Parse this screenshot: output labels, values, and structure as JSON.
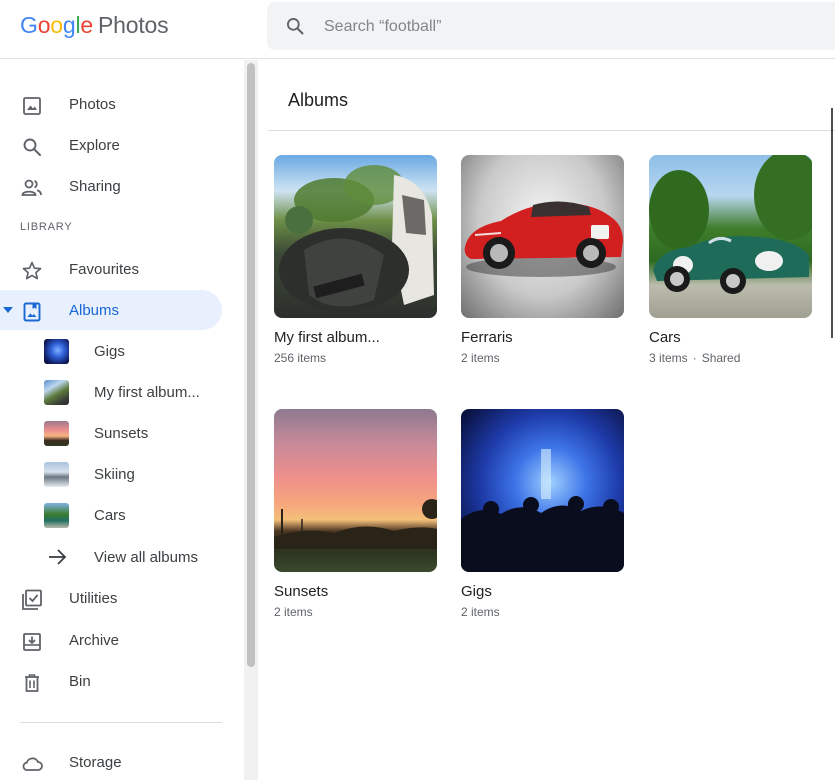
{
  "app": {
    "logo_letters": [
      "G",
      "o",
      "o",
      "g",
      "l",
      "e"
    ],
    "product_name": "Photos"
  },
  "search": {
    "placeholder": "Search “football”",
    "icon": "search-icon"
  },
  "sidebar": {
    "nav": [
      {
        "label": "Photos",
        "icon": "photo-icon"
      },
      {
        "label": "Explore",
        "icon": "search-icon"
      },
      {
        "label": "Sharing",
        "icon": "people-icon"
      }
    ],
    "library_label": "LIBRARY",
    "library": [
      {
        "label": "Favourites",
        "icon": "star-icon"
      },
      {
        "label": "Albums",
        "icon": "album-icon",
        "active": true
      }
    ],
    "albums": [
      {
        "label": "Gigs"
      },
      {
        "label": "My first album..."
      },
      {
        "label": "Sunsets"
      },
      {
        "label": "Skiing"
      },
      {
        "label": "Cars"
      }
    ],
    "view_all_label": "View all albums",
    "tools": [
      {
        "label": "Utilities",
        "icon": "utilities-icon"
      },
      {
        "label": "Archive",
        "icon": "archive-icon"
      },
      {
        "label": "Bin",
        "icon": "trash-icon"
      }
    ],
    "storage_label": "Storage"
  },
  "main": {
    "title": "Albums",
    "albums": [
      {
        "title": "My first album...",
        "count": "256 items",
        "shared": ""
      },
      {
        "title": "Ferraris",
        "count": "2 items",
        "shared": ""
      },
      {
        "title": "Cars",
        "count": "3 items",
        "shared": "Shared",
        "separator": "·"
      },
      {
        "title": "Sunsets",
        "count": "2 items",
        "shared": ""
      },
      {
        "title": "Gigs",
        "count": "2 items",
        "shared": ""
      }
    ]
  },
  "colors": {
    "accent": "#1967d2",
    "active_bg": "#e8f0fe",
    "search_bg": "#f1f3f4"
  }
}
